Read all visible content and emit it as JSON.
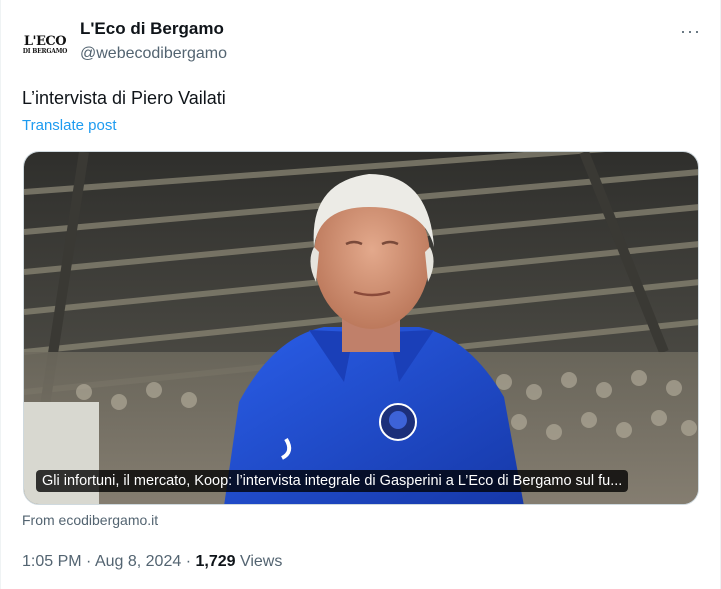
{
  "author": {
    "name": "L'Eco di Bergamo",
    "handle": "@webecodibergamo",
    "avatar_logo_top": "L'ECO",
    "avatar_logo_bottom": "DI BERGAMO"
  },
  "more_icon": "more-horizontal-icon",
  "more_label": "···",
  "tweet": {
    "text": "L’intervista di Piero Vailati",
    "translate_label": "Translate post"
  },
  "media": {
    "caption": "Gli infortuni, il mercato, Koop: l’intervista integrale di Gasperini a L’Eco di Bergamo sul fu...",
    "source": "From ecodibergamo.it"
  },
  "meta": {
    "time": "1:05 PM",
    "separator": "·",
    "date": "Aug 8, 2024",
    "views_count": "1,729",
    "views_label": "Views"
  },
  "colors": {
    "link": "#1d9bf0",
    "secondary_text": "#536471",
    "primary_text": "#0f1419",
    "jersey_blue": "#1f4fd6"
  }
}
